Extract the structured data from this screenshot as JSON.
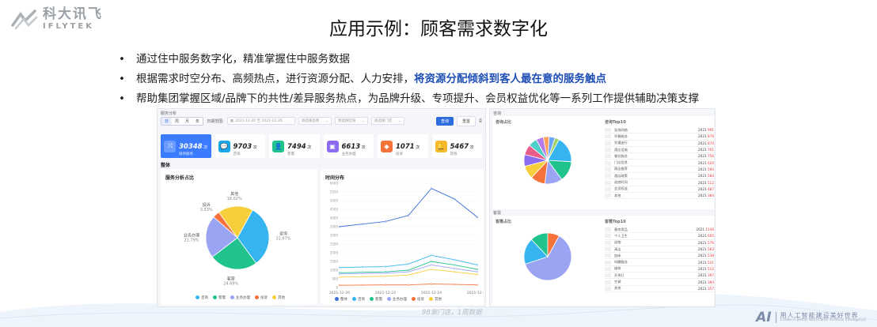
{
  "logo": {
    "cn": "科大讯飞",
    "en": "IFLYTEK"
  },
  "title": "应用示例：顾客需求数字化",
  "bullets": [
    {
      "text": "通过住中服务数字化，精准掌握住中服务数据"
    },
    {
      "text": "根据需求时空分布、高频热点，进行资源分配、人力安排，",
      "highlight": "将资源分配倾斜到客人最在意的服务触点"
    },
    {
      "text": "帮助集团掌握区域/品牌下的共性/差异服务热点，为品牌升级、专项提升、会员权益优化等一系列工作提供辅助决策支撑"
    }
  ],
  "dashboard": {
    "breadcrumb": "服务分析",
    "period_tabs": [
      "日",
      "周",
      "月",
      "年"
    ],
    "date_label": "日期范围:",
    "date_range": "2021-12-20 至 2021-12-26",
    "filters": [
      "请选择品牌",
      "请选择区域",
      "请选择门店"
    ],
    "query_button": "查询",
    "reset_button": "重置",
    "stats": [
      {
        "value": "30348",
        "unit": "次",
        "label": "接待服务",
        "color": "#3a7bff",
        "icon": "shuffle-icon"
      },
      {
        "value": "9703",
        "unit": "次",
        "label": "咨询",
        "color": "#1aa7e8",
        "icon": "chat-icon"
      },
      {
        "value": "7494",
        "unit": "次",
        "label": "客需",
        "color": "#20c28e",
        "icon": "person-icon"
      },
      {
        "value": "6613",
        "unit": "次",
        "label": "业务办理",
        "color": "#8b6cf0",
        "icon": "briefcase-icon"
      },
      {
        "value": "1071",
        "unit": "次",
        "label": "投诉",
        "color": "#f5723b",
        "icon": "cube-icon"
      },
      {
        "value": "5467",
        "unit": "次",
        "label": "其他",
        "color": "#f5b92b",
        "icon": "bell-icon"
      }
    ],
    "section_label": "整体",
    "pie_title": "服务分析占比",
    "line_title": "时间分布"
  },
  "chart_data": [
    {
      "type": "pie",
      "title": "服务分析占比",
      "categories": [
        "咨询",
        "客需",
        "业务办理",
        "投诉",
        "其他"
      ],
      "values": [
        31.97,
        24.69,
        21.79,
        3.53,
        18.02
      ],
      "value_labels": [
        "31.97%",
        "24.69%",
        "21.79%",
        "3.53%",
        "18.02%"
      ],
      "colors": [
        "#36b4ef",
        "#20c28e",
        "#9aa4f3",
        "#f5723b",
        "#f7cf3c"
      ],
      "legend": "bottom"
    },
    {
      "type": "line",
      "title": "时间分布",
      "x": [
        "2021-12-20",
        "2021-12-21",
        "2021-12-22",
        "2021-12-23",
        "2021-12-24",
        "2021-12-25",
        "2021-12-26"
      ],
      "tick_labels": [
        "2021-12-20",
        "2021-12-22",
        "2021-12-24",
        "2021-12-26"
      ],
      "ylim": [
        0,
        6000
      ],
      "yticks": [
        0,
        500,
        1000,
        1500,
        2000,
        2500,
        3000,
        3500,
        4000,
        4500,
        5000,
        5500,
        6000
      ],
      "series": [
        {
          "name": "整体",
          "color": "#3a6fd8",
          "values": [
            3500,
            3650,
            3800,
            4150,
            5700,
            5100,
            4050
          ]
        },
        {
          "name": "咨询",
          "color": "#36b4ef",
          "values": [
            1150,
            1180,
            1200,
            1350,
            1850,
            1600,
            1300
          ]
        },
        {
          "name": "客需",
          "color": "#20c28e",
          "values": [
            850,
            880,
            900,
            1000,
            1500,
            1300,
            1050
          ]
        },
        {
          "name": "业务办理",
          "color": "#9aa4f3",
          "values": [
            780,
            810,
            830,
            900,
            1300,
            1100,
            900
          ]
        },
        {
          "name": "投诉",
          "color": "#f5723b",
          "values": [
            130,
            140,
            150,
            150,
            200,
            180,
            150
          ]
        },
        {
          "name": "其他",
          "color": "#f7cf3c",
          "values": [
            600,
            620,
            650,
            720,
            1050,
            900,
            750
          ]
        }
      ],
      "grid": true,
      "legend": "bottom"
    },
    {
      "type": "pie",
      "title": "咨询占比",
      "values": [
        18,
        14,
        12,
        10,
        9,
        8,
        7,
        6,
        5,
        4,
        4,
        3
      ],
      "colors": [
        "#36b4ef",
        "#20c28e",
        "#9aa4f3",
        "#f5723b",
        "#f7cf3c",
        "#8b6cf0",
        "#e85d8a",
        "#4dd0c9",
        "#b57be8",
        "#ff9f5a",
        "#6ba3ff",
        "#9ed36a"
      ],
      "legend": "bottom"
    },
    {
      "type": "pie",
      "title": "客需占比",
      "values": [
        62,
        18,
        12,
        8
      ],
      "colors": [
        "#9aa4f3",
        "#36b4ef",
        "#20c28e",
        "#f5723b"
      ],
      "legend": "bottom"
    }
  ],
  "right_panel": {
    "top_section": "咨询",
    "top_pie_title": "咨询占比",
    "top_rank_title": "咨询Top10",
    "top_rank": [
      {
        "name": "无线网络",
        "value": "2021",
        "hot": "991"
      },
      {
        "name": "早餐服务",
        "value": "2021",
        "hot": "876"
      },
      {
        "name": "交通出行",
        "value": "2021",
        "hot": "870"
      },
      {
        "name": "酒店设施",
        "value": "2021",
        "hot": "761"
      },
      {
        "name": "餐饮服务",
        "value": "2021",
        "hot": "756"
      },
      {
        "name": "门店信息",
        "value": "2021",
        "hot": "620"
      },
      {
        "name": "周边推荐",
        "value": "2021",
        "hot": "590"
      },
      {
        "name": "酒店政策",
        "value": "2021",
        "hot": "584"
      },
      {
        "name": "退房时间",
        "value": "2021",
        "hot": "512"
      },
      {
        "name": "会员权益",
        "value": "2021",
        "hot": "487"
      },
      {
        "name": "其他",
        "value": "2021",
        "hot": "384"
      }
    ],
    "bottom_section": "客需",
    "bottom_pie_title": "客需占比",
    "bottom_rank_title": "客需Top10",
    "bottom_rank": [
      {
        "name": "客房用品",
        "value": "2021",
        "hot": "1146"
      },
      {
        "name": "个人卫生",
        "value": "2021",
        "hot": "605"
      },
      {
        "name": "送物",
        "value": "2021",
        "hot": "576"
      },
      {
        "name": "清洁",
        "value": "2021",
        "hot": "563"
      },
      {
        "name": "加床",
        "value": "2021",
        "hot": "538"
      },
      {
        "name": "叫醒服务",
        "value": "2021",
        "hot": "521"
      },
      {
        "name": "维修",
        "value": "2021",
        "hot": "512"
      },
      {
        "name": "开关灯",
        "value": "2021",
        "hot": "397"
      },
      {
        "name": "空调",
        "value": "2021",
        "hot": "384"
      },
      {
        "name": "其他",
        "value": "2021",
        "hot": "357"
      }
    ]
  },
  "watermark": "98家门店，1周数据",
  "footer": {
    "ai": "AI",
    "cn": "用人工智能建设美好世界",
    "en": "Create A Better World With Artificial Intelligence"
  }
}
